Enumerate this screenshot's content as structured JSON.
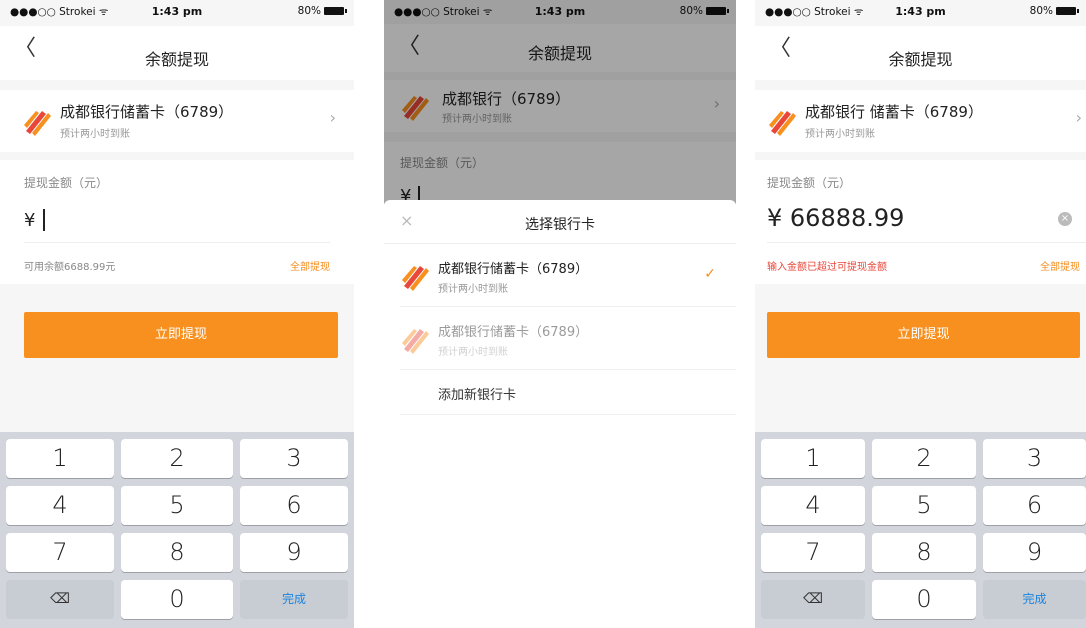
{
  "status_bar": {
    "carrier": "●●●○○ Strokei ᯤ",
    "time": "1:43 pm",
    "battery": "80%"
  },
  "nav": {
    "back": "〈",
    "title": "余额提现"
  },
  "screen1": {
    "card_name": "成都银行储蓄卡（6789）",
    "card_sub": "预计两小时到账",
    "chevron": "›",
    "amount_label": "提现金额（元）",
    "currency": "¥",
    "available": "可用余额6688.99元",
    "withdraw_all": "全部提现",
    "submit": "立即提现"
  },
  "screen2": {
    "card_name": "成都银行（6789）",
    "card_sub": "预计两小时到账",
    "chevron": "›",
    "amount_label": "提现金额（元）",
    "currency": "¥",
    "sheet_title": "选择银行卡",
    "close": "×",
    "options": [
      {
        "name": "成都银行储蓄卡（6789）",
        "sub": "预计两小时到账",
        "check": "✓"
      },
      {
        "name": "成都银行储蓄卡（6789）",
        "sub": "预计两小时到账"
      }
    ],
    "add_card": "添加新银行卡"
  },
  "screen3": {
    "card_name": "成都银行 储蓄卡（6789）",
    "card_sub": "预计两小时到账",
    "chevron": "›",
    "amount_label": "提现金额（元）",
    "amount_value": "¥ 66888.99",
    "clear": "×",
    "error": "输入金额已超过可提现金额",
    "withdraw_all": "全部提现",
    "submit": "立即提现"
  },
  "keypad": {
    "keys": [
      "1",
      "2",
      "3",
      "4",
      "5",
      "6",
      "7",
      "8",
      "9",
      "⌫",
      "0",
      "完成"
    ]
  },
  "colors": {
    "accent": "#f7901e",
    "error": "#e8473a",
    "done_key": "#1a84e0"
  }
}
